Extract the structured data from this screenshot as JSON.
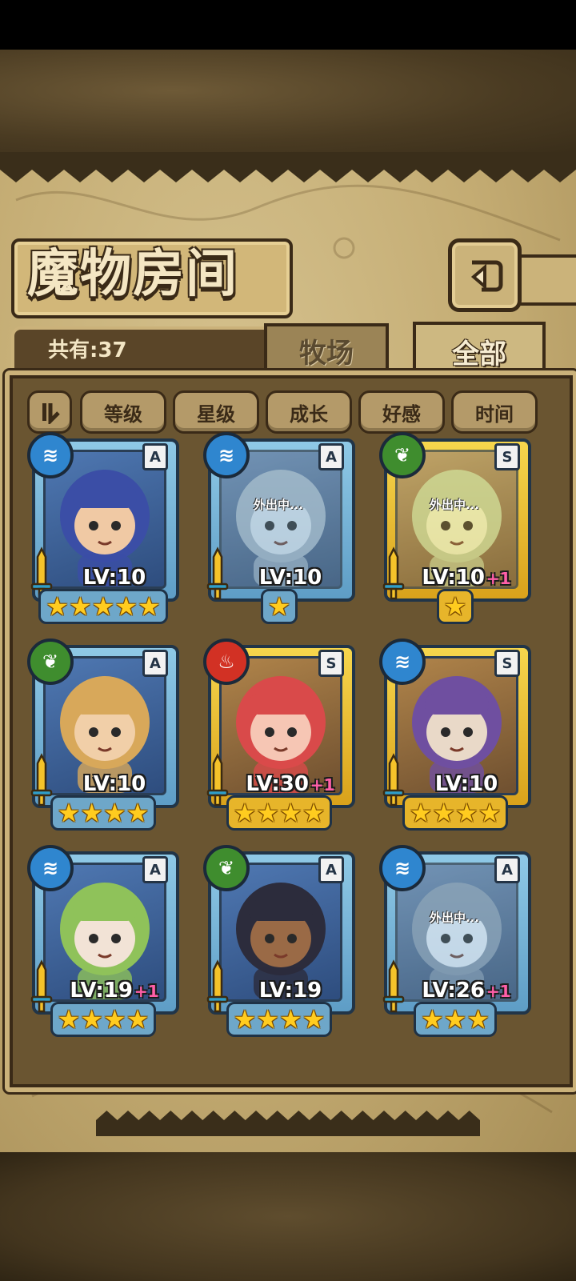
{
  "page": {
    "title": "魔物房间",
    "count_label": "共有:37",
    "tabs": [
      {
        "label": "牧场",
        "active": false
      },
      {
        "label": "全部",
        "active": true
      }
    ],
    "sort_buttons": [
      "等级",
      "星级",
      "成长",
      "好感",
      "时间"
    ],
    "out_label": "外出中..."
  },
  "colors": {
    "water": "#2f86cf",
    "wood": "#3f8d2e",
    "fire": "#d23124",
    "plus": "#ff5fa8",
    "star": "#ffcc1f"
  },
  "cards": [
    {
      "element": "water",
      "rank": "A",
      "frame": "blue",
      "level": "LV:10",
      "plus": "",
      "stars": 5,
      "out": false
    },
    {
      "element": "water",
      "rank": "A",
      "frame": "blue",
      "level": "LV:10",
      "plus": "",
      "stars": 1,
      "out": true
    },
    {
      "element": "wood",
      "rank": "S",
      "frame": "gold",
      "level": "LV:10",
      "plus": "+1",
      "stars": 1,
      "out": true
    },
    {
      "element": "wood",
      "rank": "A",
      "frame": "blue",
      "level": "LV:10",
      "plus": "",
      "stars": 4,
      "out": false
    },
    {
      "element": "fire",
      "rank": "S",
      "frame": "gold",
      "level": "LV:30",
      "plus": "+1",
      "stars": 4,
      "out": false
    },
    {
      "element": "water",
      "rank": "S",
      "frame": "gold",
      "level": "LV:10",
      "plus": "",
      "stars": 4,
      "out": false
    },
    {
      "element": "water",
      "rank": "A",
      "frame": "blue",
      "level": "LV:19",
      "plus": "+1",
      "stars": 4,
      "out": false
    },
    {
      "element": "wood",
      "rank": "A",
      "frame": "blue",
      "level": "LV:19",
      "plus": "",
      "stars": 4,
      "out": false
    },
    {
      "element": "water",
      "rank": "A",
      "frame": "blue",
      "level": "LV:26",
      "plus": "+1",
      "stars": 3,
      "out": true
    }
  ]
}
